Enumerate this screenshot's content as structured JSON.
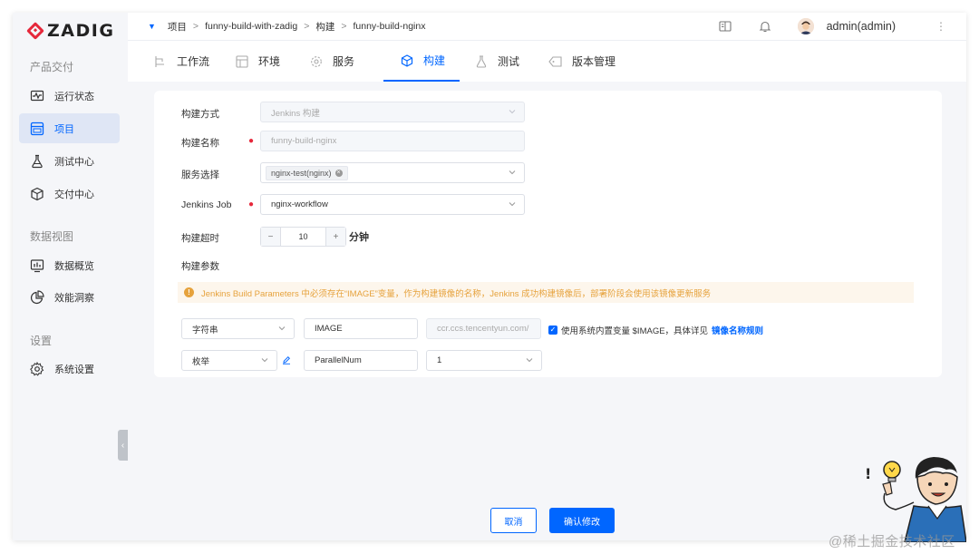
{
  "app": {
    "logo_text": "ZADIG",
    "brand_color": "#e6283b",
    "accent_color": "#0066ff"
  },
  "sidebar": {
    "sections": [
      {
        "title": "产品交付",
        "items": [
          {
            "label": "运行状态",
            "icon": "pulse-monitor-icon"
          },
          {
            "label": "项目",
            "icon": "project-board-icon",
            "active": true
          },
          {
            "label": "测试中心",
            "icon": "flask-icon"
          },
          {
            "label": "交付中心",
            "icon": "delivery-box-icon"
          }
        ]
      },
      {
        "title": "数据视图",
        "items": [
          {
            "label": "数据概览",
            "icon": "chart-monitor-icon"
          },
          {
            "label": "效能洞察",
            "icon": "pie-chart-icon"
          }
        ]
      },
      {
        "title": "设置",
        "items": [
          {
            "label": "系统设置",
            "icon": "gear-icon"
          }
        ]
      }
    ]
  },
  "header": {
    "breadcrumb": [
      "项目",
      "funny-build-with-zadig",
      "构建",
      "funny-build-nginx"
    ],
    "username": "admin(admin)"
  },
  "tabs": [
    {
      "label": "工作流",
      "icon": "workflow-icon"
    },
    {
      "label": "环境",
      "icon": "environment-icon"
    },
    {
      "label": "服务",
      "icon": "service-gear-icon"
    },
    {
      "label": "构建",
      "icon": "build-cube-icon",
      "active": true
    },
    {
      "label": "测试",
      "icon": "test-flask-icon"
    },
    {
      "label": "版本管理",
      "icon": "version-tag-icon"
    }
  ],
  "form": {
    "build_method": {
      "label": "构建方式",
      "value": "Jenkins 构建"
    },
    "build_name": {
      "label": "构建名称",
      "value": "funny-build-nginx"
    },
    "service_select": {
      "label": "服务选择",
      "tag": "nginx-test(nginx)"
    },
    "jenkins_job": {
      "label": "Jenkins Job",
      "value": "nginx-workflow"
    },
    "timeout": {
      "label": "构建超时",
      "value": "10",
      "unit": "分钟",
      "minus": "−",
      "plus": "+"
    },
    "params": {
      "label": "构建参数",
      "alert": "Jenkins Build Parameters 中必须存在“IMAGE”变量，作为构建镜像的名称，Jenkins 成功构建镜像后，部署阶段会使用该镜像更新服务",
      "rows": [
        {
          "type": "字符串",
          "name": "IMAGE",
          "value": "ccr.ccs.tencentyun.com/"
        },
        {
          "type": "枚举",
          "name": "ParallelNum",
          "value": "1"
        }
      ],
      "checkbox_text": "使用系统内置变量 $IMAGE，具体详见",
      "checkbox_link": "镜像名称规则"
    }
  },
  "footer": {
    "cancel": "取消",
    "confirm": "确认修改"
  },
  "watermark": "@稀土掘金技术社区"
}
